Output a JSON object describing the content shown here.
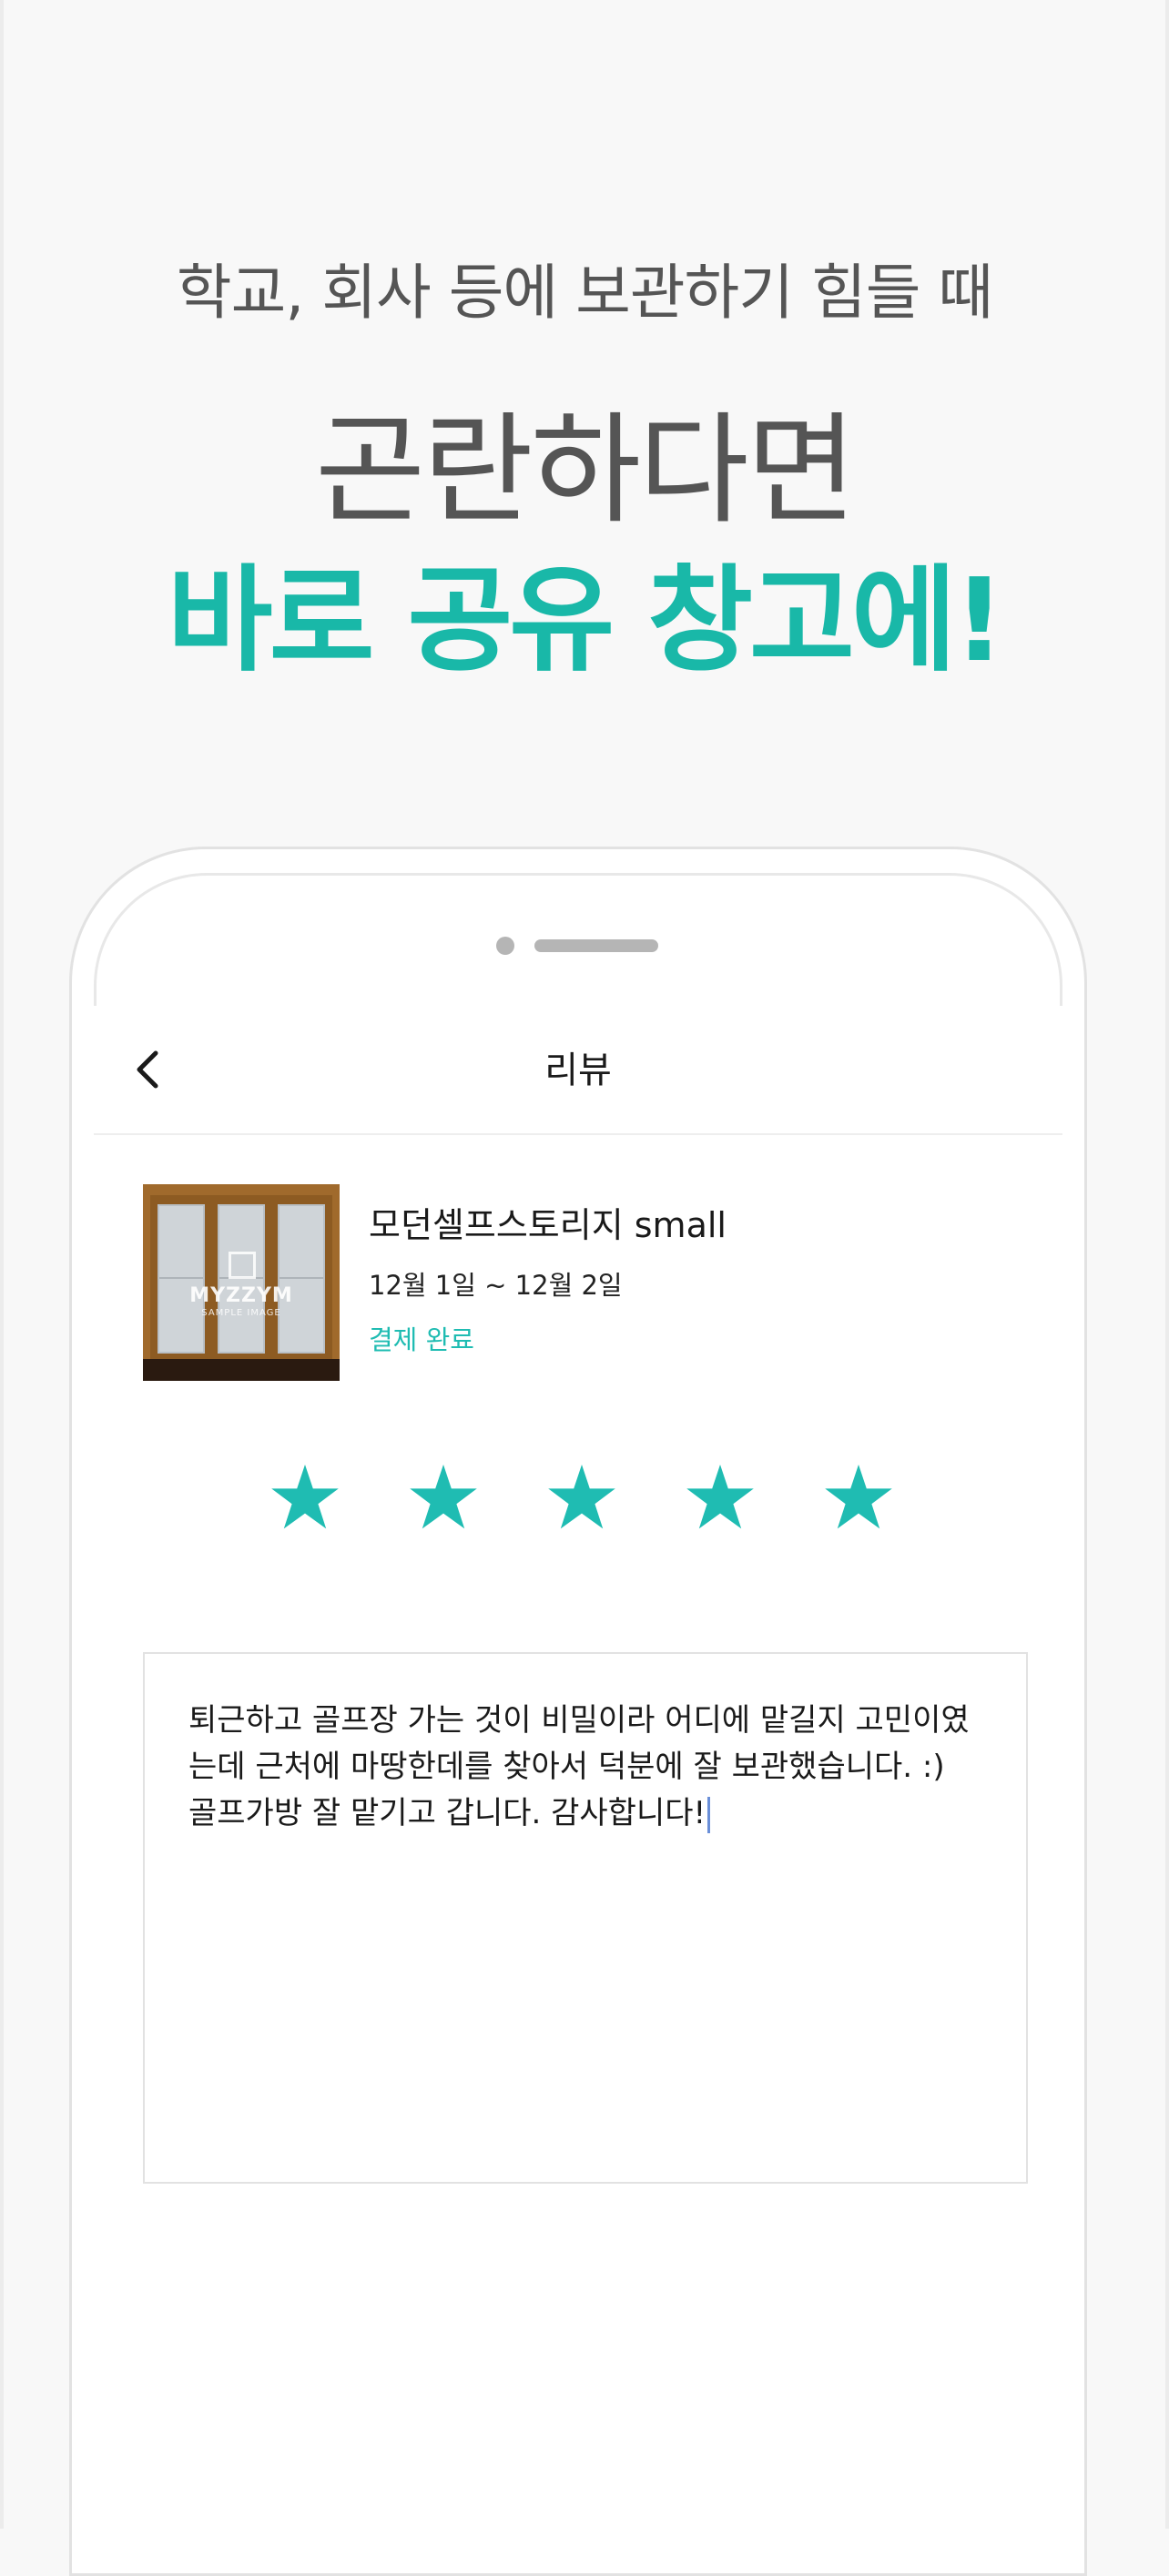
{
  "promo": {
    "subtitle": "학교, 회사 등에 보관하기 힘들 때",
    "heading_line1": "곤란하다면",
    "heading_line2": "바로 공유 창고에!",
    "accent_color": "#19b8a8"
  },
  "screen": {
    "nav": {
      "title": "리뷰",
      "back_icon": "chevron-left-icon"
    },
    "product": {
      "name": "모던셀프스토리지 small",
      "dates": "12월 1일 ~ 12월 2일",
      "status": "결제 완료",
      "thumbnail_watermark": "MYZZYM",
      "thumbnail_watermark_sub": "SAMPLE IMAGE"
    },
    "rating": {
      "value": 5,
      "max": 5,
      "star_icon": "star-icon",
      "star_color": "#1fbcb2"
    },
    "review": {
      "text": "퇴근하고 골프장 가는 것이 비밀이라 어디에 맡길지 고민이였는데 근처에 마땅한데를 찾아서 덕분에 잘 보관했습니다. :) 골프가방 잘 맡기고 갑니다. 감사합니다!"
    }
  }
}
